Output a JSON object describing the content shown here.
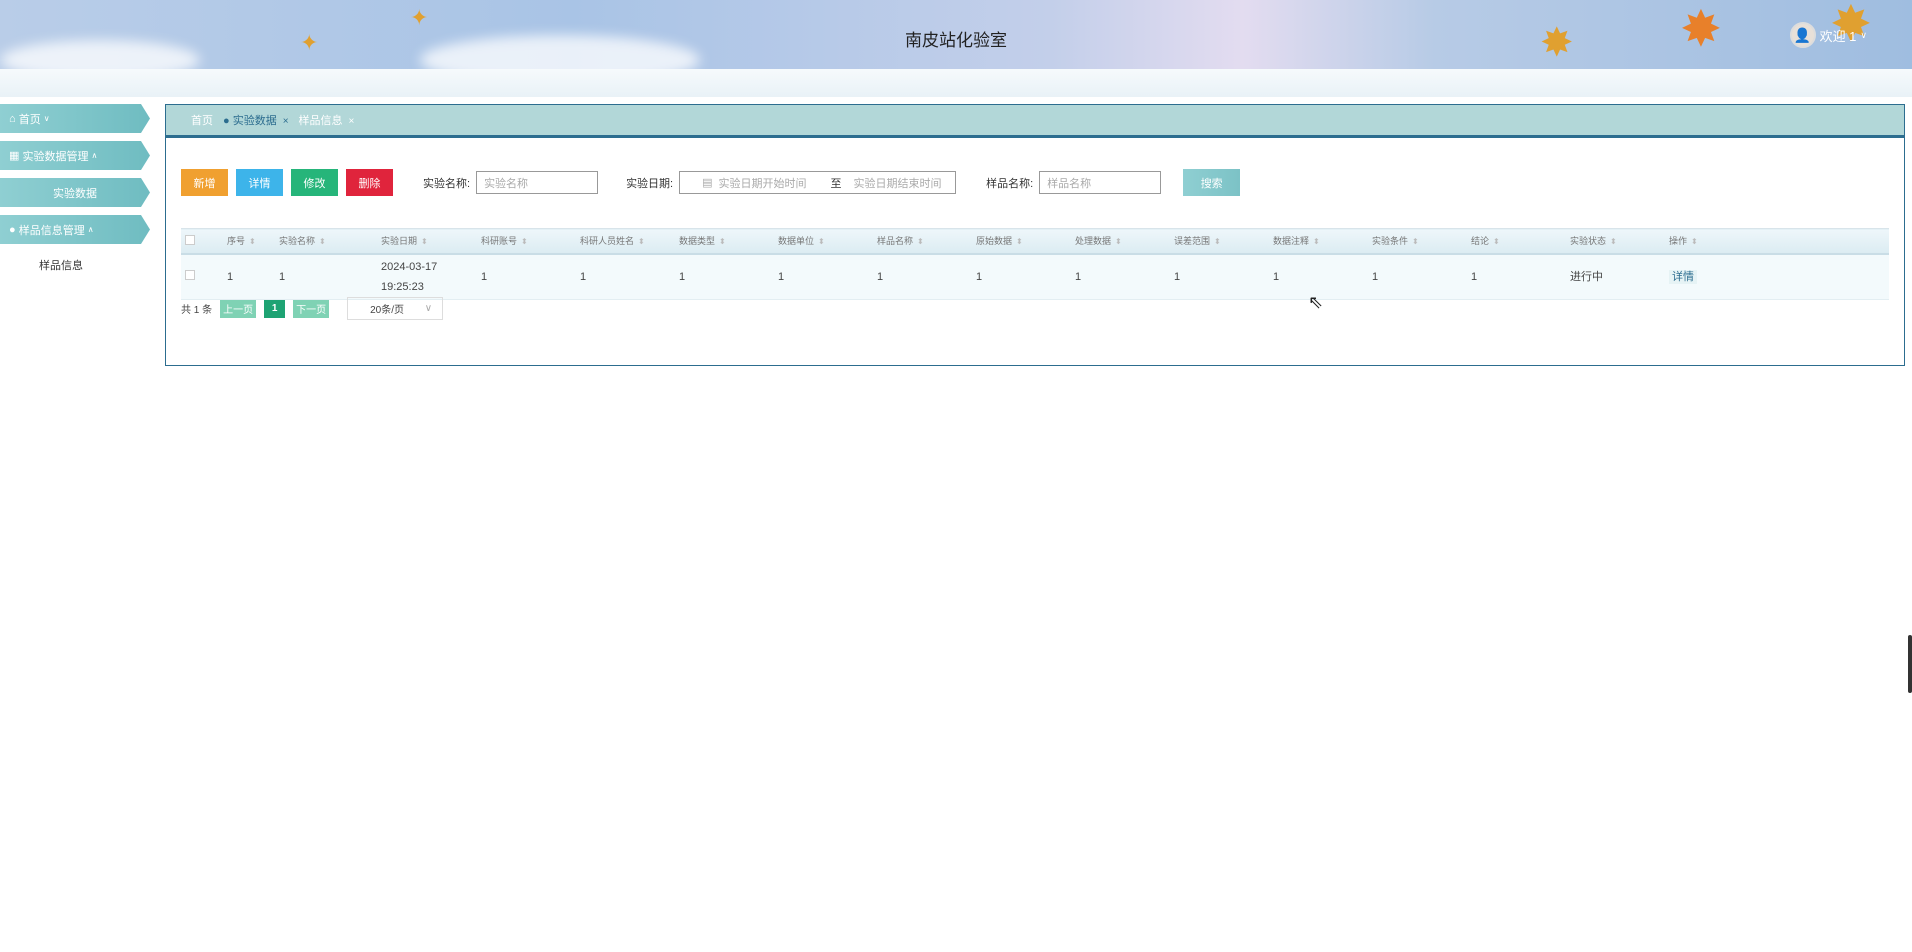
{
  "header": {
    "title": "南皮站化验室",
    "user": "欢迎 1"
  },
  "sidebar": {
    "home": "首页",
    "group1": "实验数据管理",
    "group1_item": "实验数据",
    "group2": "样品信息管理",
    "group2_item": "样品信息"
  },
  "tabs": [
    {
      "label": "首页"
    },
    {
      "label": "实验数据",
      "close": "×"
    },
    {
      "label": "样品信息",
      "close": "×"
    }
  ],
  "toolbar": {
    "add": "新增",
    "detail": "详情",
    "edit": "修改",
    "delete": "删除",
    "name_label": "实验名称:",
    "name_placeholder": "实验名称",
    "date_label": "实验日期:",
    "date_start": "实验日期开始时间",
    "date_to": "至",
    "date_end": "实验日期结束时间",
    "sample_label": "样品名称:",
    "sample_placeholder": "样品名称",
    "search": "搜索"
  },
  "table": {
    "headers": [
      "序号",
      "实验名称",
      "实验日期",
      "科研账号",
      "科研人员姓名",
      "数据类型",
      "数据单位",
      "样品名称",
      "原始数据",
      "处理数据",
      "误差范围",
      "数据注释",
      "实验条件",
      "结论",
      "实验状态",
      "操作"
    ],
    "rows": [
      {
        "cells": [
          "1",
          "1",
          "2024-03-17 19:25:23",
          "1",
          "1",
          "1",
          "1",
          "1",
          "1",
          "1",
          "1",
          "1",
          "1",
          "1",
          "进行中"
        ],
        "action": "详情"
      }
    ]
  },
  "pager": {
    "total": "共 1 条",
    "prev": "上一页",
    "page": "1",
    "next": "下一页",
    "size": "20条/页"
  },
  "colors": {
    "add": "#f0a030",
    "detail": "#3db4ea",
    "edit": "#26b57a",
    "delete": "#e0243c",
    "theme": "#2c6d8f"
  }
}
